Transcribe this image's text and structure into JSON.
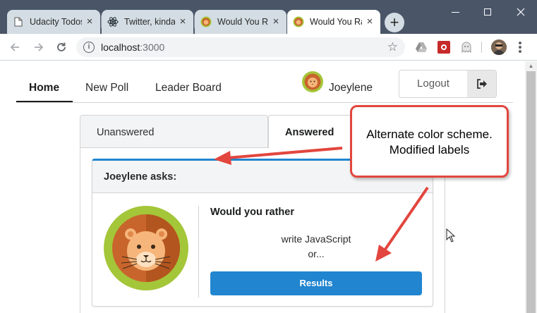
{
  "browser": {
    "tabs": [
      {
        "title": "Udacity Todos",
        "icon": "document-icon",
        "active": false
      },
      {
        "title": "Twitter, kinda",
        "icon": "react-icon",
        "active": false
      },
      {
        "title": "Would You Rather",
        "icon": "lion-icon",
        "active": false
      },
      {
        "title": "Would You Rather",
        "icon": "lion-icon",
        "active": true
      }
    ],
    "new_tab_label": "+",
    "address": {
      "host": "localhost",
      "port": ":3000"
    },
    "colors": {
      "frame": "#4a5668",
      "tab_inactive": "#d3dde3"
    }
  },
  "app": {
    "nav": {
      "items": [
        {
          "label": "Home",
          "active": true
        },
        {
          "label": "New Poll",
          "active": false
        },
        {
          "label": "Leader Board",
          "active": false
        }
      ],
      "user_name": "Joeylene",
      "logout_label": "Logout"
    },
    "tabs": {
      "unanswered": "Unanswered",
      "answered": "Answered",
      "selected": "answered"
    },
    "card": {
      "header": "Joeylene asks:",
      "question_title": "Would you rather",
      "option": "write JavaScript",
      "or_text": "or...",
      "button_label": "Results"
    },
    "colors": {
      "accent": "#2185d0",
      "border": "#d4d4d5",
      "header_bg": "#f3f4f5"
    }
  },
  "annotation": {
    "text": "Alternate color scheme.\nModified labels",
    "color": "#e2463e"
  }
}
